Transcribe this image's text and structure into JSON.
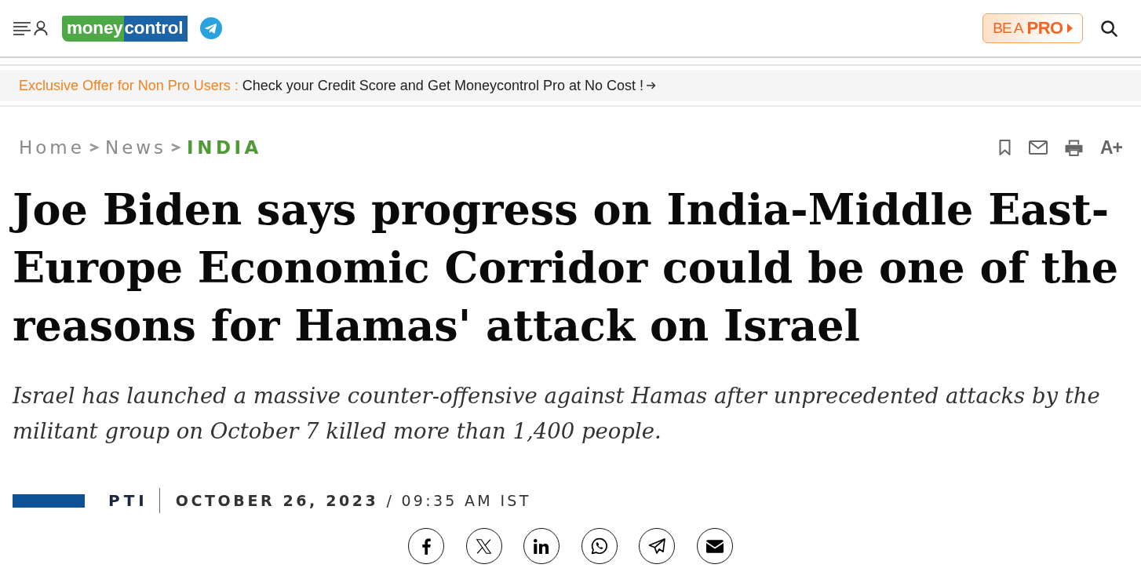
{
  "header": {
    "logo": {
      "part_1": "money",
      "part_2": "control"
    },
    "pro_button": {
      "prefix": "BE A",
      "label": "PRO"
    }
  },
  "offer_bar": {
    "label": "Exclusive Offer for Non Pro Users :",
    "link": "Check your Credit Score and Get Moneycontrol Pro at No Cost !"
  },
  "breadcrumb": [
    {
      "label": "Home",
      "current": false
    },
    {
      "label": "News",
      "current": false
    },
    {
      "label": "INDIA",
      "current": true
    }
  ],
  "article_tools": [
    {
      "kind": "bookmark"
    },
    {
      "kind": "email"
    },
    {
      "kind": "print"
    },
    {
      "kind": "font_size",
      "label": "A+"
    }
  ],
  "article": {
    "title": "Joe Biden says progress on India-Middle East-Europe Economic Corridor could be one of the reasons for Hamas' attack on Israel",
    "summary": "Israel has launched a massive counter-offensive against Hamas after unprecedented attacks by the militant group on October 7 killed more than 1,400 people.",
    "byline": {
      "author": "PTI",
      "date": "OCTOBER 26, 2023",
      "time": "/ 09:35 AM IST"
    }
  },
  "share_buttons": [
    {
      "kind": "facebook"
    },
    {
      "kind": "x"
    },
    {
      "kind": "linkedin"
    },
    {
      "kind": "whatsapp"
    },
    {
      "kind": "telegram"
    },
    {
      "kind": "email"
    }
  ]
}
